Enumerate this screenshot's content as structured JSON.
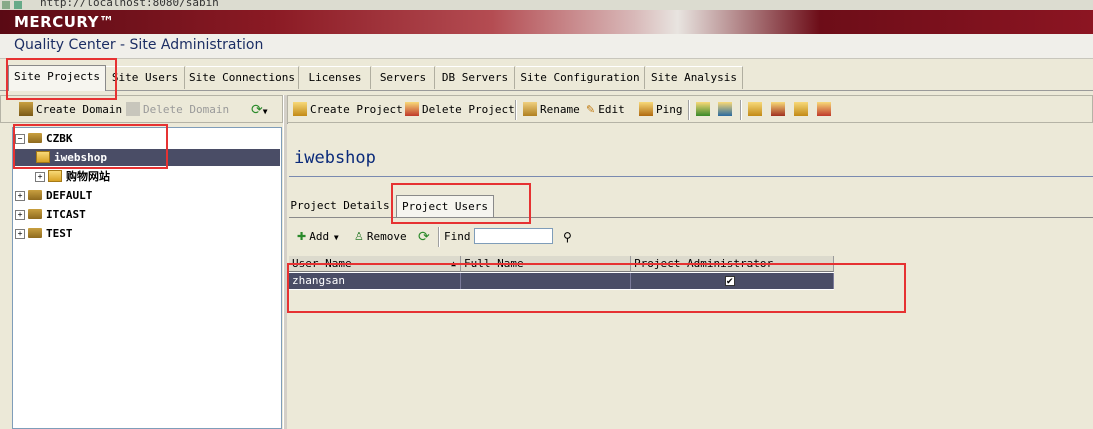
{
  "browser": {
    "url": "http://localhost:8080/sabin"
  },
  "brand": {
    "logo": "MERCURY™",
    "subtitle": "Quality Center - Site Administration"
  },
  "tabs": [
    "Site Projects",
    "Site Users",
    "Site Connections",
    "Licenses",
    "Servers",
    "DB Servers",
    "Site Configuration",
    "Site Analysis"
  ],
  "left_toolbar": {
    "create_domain": "Create Domain",
    "delete_domain": "Delete Domain",
    "refresh_icon": "refresh-icon"
  },
  "tree": {
    "nodes": [
      {
        "label": "CZBK"
      },
      {
        "label": "iwebshop"
      },
      {
        "label": "购物网站"
      },
      {
        "label": "DEFAULT"
      },
      {
        "label": "ITCAST"
      },
      {
        "label": "TEST"
      }
    ]
  },
  "right_toolbar": {
    "create_project": "Create Project",
    "delete_project": "Delete Project",
    "rename": "Rename",
    "edit": "Edit",
    "ping": "Ping"
  },
  "project": {
    "title": "iwebshop"
  },
  "project_tabs": [
    "Project Details",
    "Project Users"
  ],
  "users_toolbar": {
    "add": "Add",
    "remove": "Remove",
    "find_label": "Find",
    "find_value": ""
  },
  "users_grid": {
    "columns": [
      "User Name",
      "Full Name",
      "Project Administrator"
    ],
    "rows": [
      {
        "user_name": "zhangsan",
        "full_name": "",
        "project_admin": true
      }
    ]
  },
  "colors": {
    "brand_red": "#8b1a24",
    "selection": "#4a4d66",
    "annotation_red": "#e63232",
    "title_blue": "#0a2a7a"
  }
}
